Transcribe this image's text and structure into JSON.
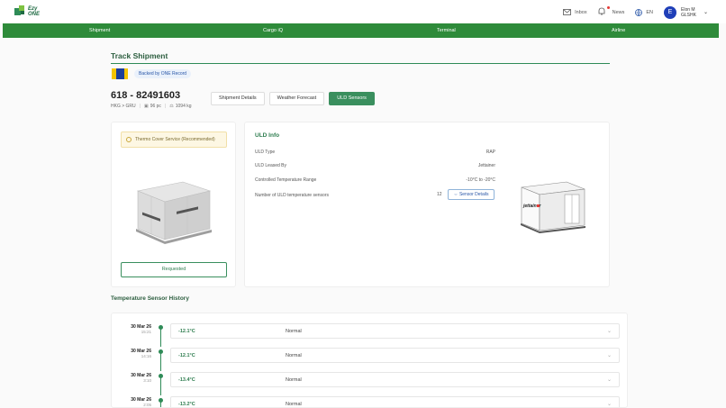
{
  "brand": {
    "line1": "Ezy",
    "line2": "ONE"
  },
  "header": {
    "inbox": "Inbox",
    "news": "News",
    "lang": "EN",
    "avatar_initial": "E",
    "user_name": "Elon M",
    "user_org": "GLSHK"
  },
  "nav": {
    "items": [
      "Shipment",
      "Cargo iQ",
      "Terminal",
      "Airline"
    ]
  },
  "page": {
    "title": "Track Shipment",
    "badge": "Backed by ONE Record",
    "awb": "618 - 82491603",
    "route": "HKG > GRU",
    "pieces": "96 pc",
    "weight": "1094 kg",
    "tabs": [
      "Shipment Details",
      "Weather Forecast",
      "ULD Sensors"
    ],
    "active_tab": "ULD Sensors"
  },
  "left_card": {
    "notice": "Thermo Cover Service (Recommended)",
    "button": "Requested"
  },
  "uld_info": {
    "title": "ULD Info",
    "rows": [
      {
        "label": "ULD Type",
        "value": "RAP"
      },
      {
        "label": "ULD Leased By",
        "value": "Jettainer"
      },
      {
        "label": "Controlled Temperature Range",
        "value": "-10°C to -20°C"
      },
      {
        "label": "Number of ULD temperature sensors",
        "value": "12"
      }
    ],
    "sensor_button": "Sensor Details",
    "container_brand": "jettainer"
  },
  "history": {
    "title": "Temperature Sensor History",
    "entries": [
      {
        "date": "30 Mar 26",
        "time": "15:21",
        "temp": "-12.1°C",
        "status": "Normal"
      },
      {
        "date": "30 Mar 26",
        "time": "14:16",
        "temp": "-12.1°C",
        "status": "Normal"
      },
      {
        "date": "30 Mar 26",
        "time": "3:10",
        "temp": "-13.4°C",
        "status": "Normal"
      },
      {
        "date": "30 Mar 26",
        "time": "2:05",
        "temp": "-13.2°C",
        "status": "Normal"
      }
    ]
  },
  "colors": {
    "primary": "#2e8b3a",
    "accent": "#3a8f5e",
    "link": "#2a57a8"
  }
}
